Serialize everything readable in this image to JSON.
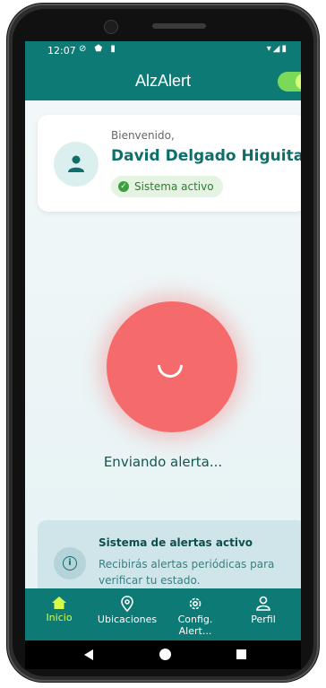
{
  "status_bar": {
    "time": "12:07",
    "left_icons": "⊘ ⬟ ▮",
    "right_icons": "▾◢▮"
  },
  "app_bar": {
    "title": "AlzAlert",
    "toggle_on": true
  },
  "user_card": {
    "welcome": "Bienvenido,",
    "name": "David Delgado Higuita",
    "status_badge": "Sistema activo"
  },
  "alert": {
    "state_text": "Enviando alerta..."
  },
  "info_card": {
    "title": "Sistema de alertas activo",
    "text": "Recibirás alertas periódicas para verificar tu estado."
  },
  "bottom_nav": {
    "items": [
      {
        "label": "Inicio",
        "icon": "home-icon",
        "active": true
      },
      {
        "label": "Ubicaciones",
        "icon": "location-pin-icon",
        "active": false
      },
      {
        "label": "Config. Alert...",
        "icon": "gear-icon",
        "active": false
      },
      {
        "label": "Perfil",
        "icon": "person-icon",
        "active": false
      }
    ]
  },
  "colors": {
    "primary": "#0d7a76",
    "accent": "#d6ff4a",
    "alert": "#f56a6a",
    "success": "#3aa13f"
  }
}
